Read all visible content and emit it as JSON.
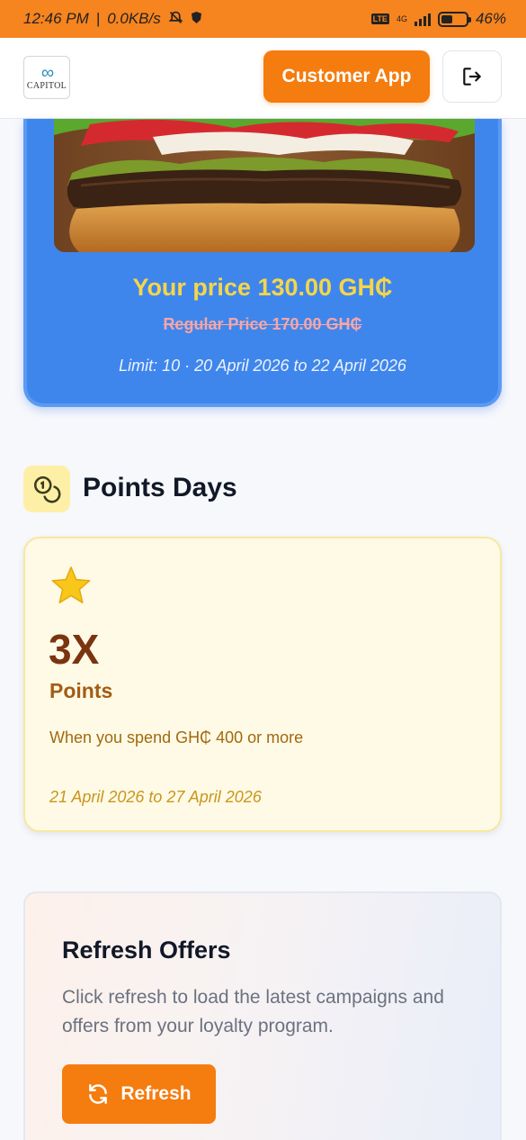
{
  "status_bar": {
    "time": "12:46 PM",
    "speed": "0.0KB/s",
    "network": "4G",
    "lte": "LTE",
    "battery_level": 0.46,
    "battery_text": "46%"
  },
  "header": {
    "logo_text": "CAPITOL",
    "customer_app_label": "Customer App",
    "logout_icon": "logout-icon"
  },
  "offer": {
    "price_text": "Your price 130.00 GH₵",
    "regular_text": "Regular Price 170.00 GH₵",
    "limit_text": "Limit: 10 · 20 April 2026 to 22 April 2026"
  },
  "points_section": {
    "title": "Points Days",
    "icon": "coins-icon",
    "card": {
      "icon": "star-icon",
      "multiplier": "3X",
      "label": "Points",
      "condition": "When you spend GH₵ 400 or more",
      "dates": "21 April 2026 to 27 April 2026"
    }
  },
  "refresh_section": {
    "title": "Refresh Offers",
    "description": "Click refresh to load the latest campaigns and offers from your loyalty program.",
    "button_label": "Refresh",
    "button_icon": "refresh-icon"
  },
  "colors": {
    "status_bar": "#f6841f",
    "accent": "#f57c0e",
    "offer_card": "#3f86ec",
    "price": "#f5d64a",
    "points_card": "#fefae6"
  }
}
